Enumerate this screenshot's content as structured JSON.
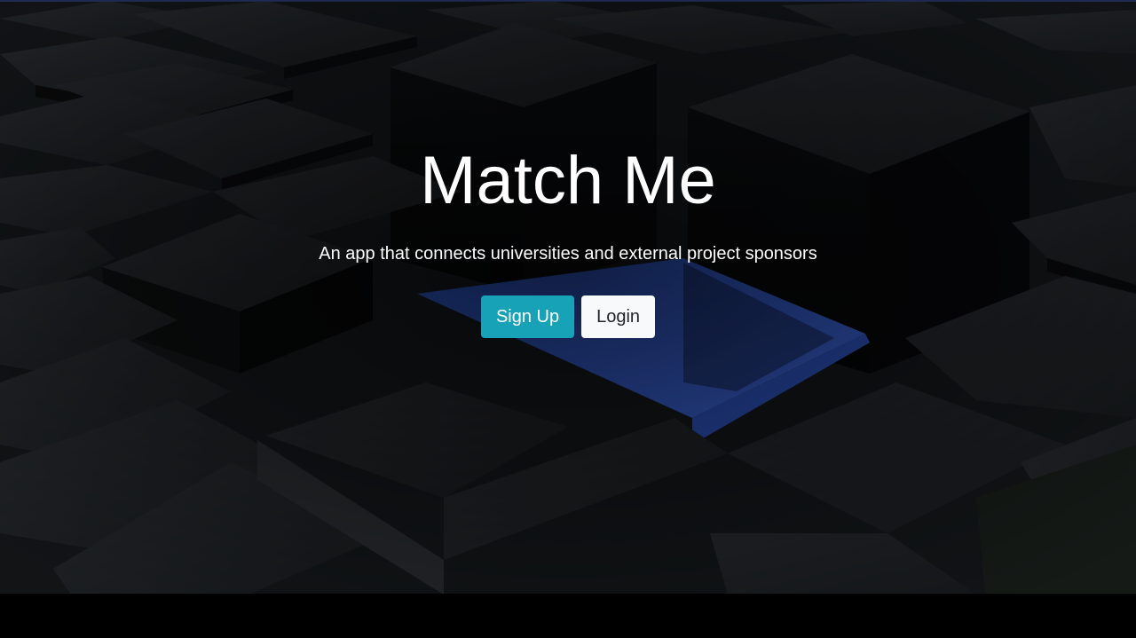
{
  "hero": {
    "title": "Match Me",
    "subtitle": "An app that connects universities and external project sponsors"
  },
  "buttons": {
    "signup_label": "Sign Up",
    "login_label": "Login"
  },
  "colors": {
    "signup_bg": "#17a2b8",
    "login_bg": "#f8f9fa",
    "accent_tile": "#3a66dc",
    "background": "#000000"
  }
}
